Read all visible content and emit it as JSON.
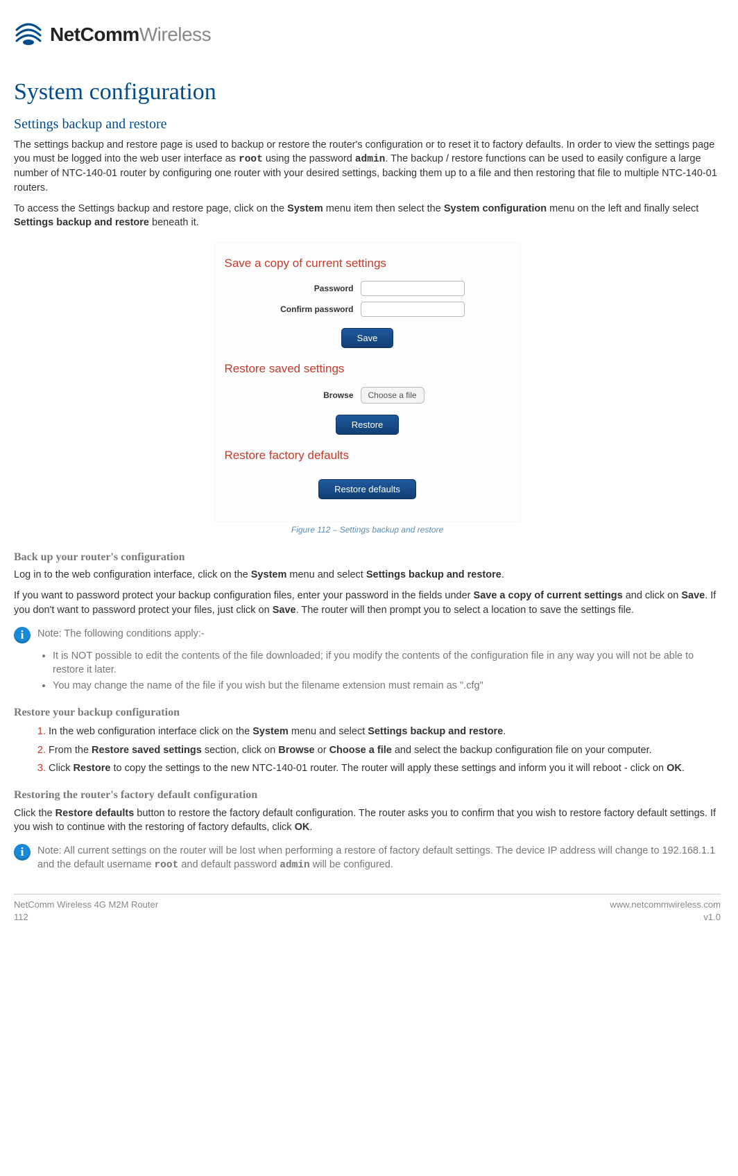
{
  "logo": {
    "bold": "NetComm",
    "light": "Wireless"
  },
  "title": "System configuration",
  "s1": {
    "heading": "Settings backup and restore",
    "p1a": "The settings backup and restore page is used to backup or restore the router's configuration or to reset it to factory defaults. In order to view the settings page you must be logged into the web user interface as ",
    "p1_root": "root",
    "p1b": " using the password ",
    "p1_admin": "admin",
    "p1c": ". The backup / restore functions can be used to easily configure a large number of NTC-140-01 router by configuring one router with your desired settings, backing them up to a file and then restoring that file to multiple NTC-140-01 routers.",
    "p2a": "To access the Settings backup and restore page, click on the ",
    "p2_system": "System",
    "p2b": " menu item then select the ",
    "p2_sysconfig": "System configuration",
    "p2c": " menu on the left and finally select ",
    "p2_sbr": "Settings backup and restore",
    "p2d": " beneath it."
  },
  "screenshot": {
    "h1": "Save a copy of current settings",
    "pwd_label": "Password",
    "cpwd_label": "Confirm password",
    "save_btn": "Save",
    "h2": "Restore saved settings",
    "browse_label": "Browse",
    "choose_file": "Choose a file",
    "restore_btn": "Restore",
    "h3": "Restore factory defaults",
    "defaults_btn": "Restore defaults"
  },
  "caption": "Figure 112 – Settings backup and restore",
  "backup": {
    "heading": "Back up your router's configuration",
    "p1a": "Log in to the web configuration interface, click on the ",
    "p1_system": "System",
    "p1b": " menu and select ",
    "p1_sbr": "Settings backup and restore",
    "p1c": ".",
    "p2a": "If you want to password protect your backup configuration files, enter your password in the fields under ",
    "p2_save_section": "Save a copy of current settings",
    "p2b": " and click on ",
    "p2_save": "Save",
    "p2c": ". If you don't want to password protect your files, just click on ",
    "p2_save2": "Save",
    "p2d": ". The router will then prompt you to select a location to save the settings file."
  },
  "note1": {
    "label": "Note: The following conditions apply:-",
    "b1": "It is NOT possible to edit the contents of the file downloaded; if you modify the contents of the configuration file in any way you will not be able to restore it later.",
    "b2": "You may change the name of the file if you wish but the filename extension must remain as \".cfg\""
  },
  "restore": {
    "heading": "Restore your backup configuration",
    "s1a": "In the web configuration interface click on the ",
    "s1_system": "System",
    "s1b": " menu and select ",
    "s1_sbr": "Settings backup and restore",
    "s1c": ".",
    "s2a": "From the ",
    "s2_rss": "Restore saved settings",
    "s2b": " section, click on ",
    "s2_browse": "Browse",
    "s2c": " or ",
    "s2_choose": "Choose a file",
    "s2d": " and select the backup configuration file on your computer.",
    "s3a": "Click ",
    "s3_restore": "Restore",
    "s3b": " to copy the settings to the new NTC-140-01 router. The router will apply these settings and inform you it will reboot - click on ",
    "s3_ok": "OK",
    "s3c": "."
  },
  "factory": {
    "heading": "Restoring the router's factory default configuration",
    "p1a": "Click the ",
    "p1_rd": "Restore defaults",
    "p1b": " button to restore the factory default configuration. The router asks you to confirm that you wish to restore factory default settings. If you wish to continue with the restoring of factory defaults, click ",
    "p1_ok": "OK",
    "p1c": "."
  },
  "note2": {
    "a": "Note: All current settings on the router will be lost when performing a restore of factory default settings. The device IP address will change to 192.168.1.1 and the default username ",
    "root": "root",
    "b": " and default password ",
    "admin": "admin",
    "c": " will be configured."
  },
  "footer": {
    "left1": "NetComm Wireless 4G M2M Router",
    "left2": "112",
    "right1": "www.netcommwireless.com",
    "right2": "v1.0"
  }
}
